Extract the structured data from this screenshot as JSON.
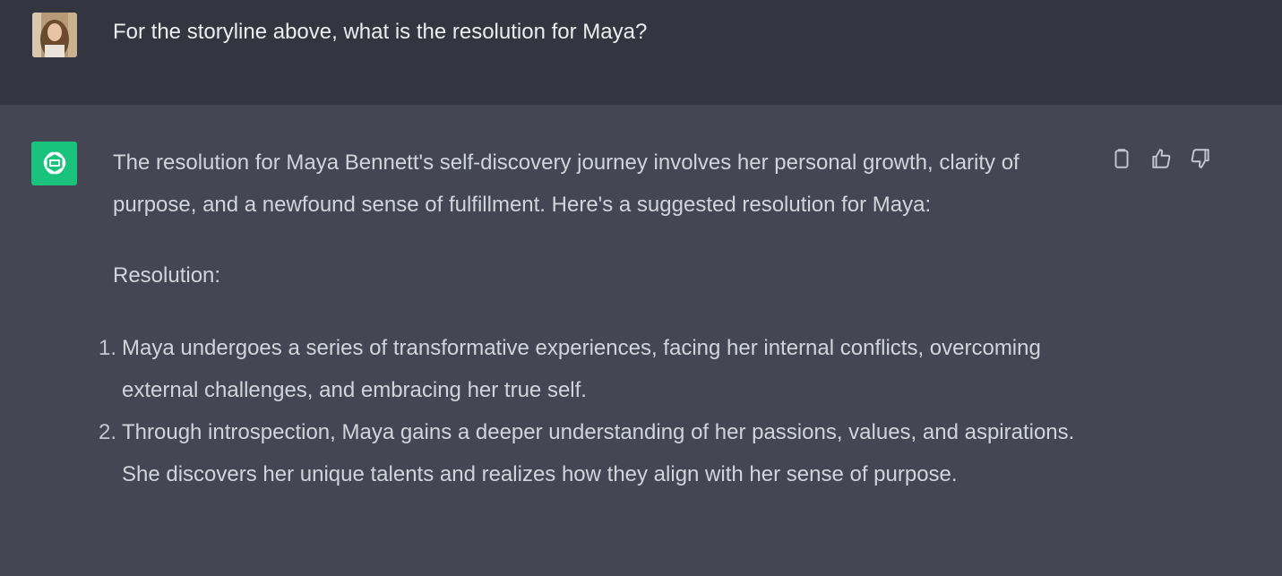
{
  "user_message": {
    "text": "For the storyline above, what is the resolution for Maya?"
  },
  "assistant_message": {
    "intro": "The resolution for Maya Bennett's self-discovery journey involves her personal growth, clarity of purpose, and a newfound sense of fulfillment. Here's a suggested resolution for Maya:",
    "heading": "Resolution:",
    "list": [
      {
        "number": "1.",
        "text": "Maya undergoes a series of transformative experiences, facing her internal conflicts, overcoming external challenges, and embracing her true self."
      },
      {
        "number": "2.",
        "text": "Through introspection, Maya gains a deeper understanding of her passions, values, and aspirations. She discovers her unique talents and realizes how they align with her sense of purpose."
      }
    ]
  },
  "actions": {
    "copy_icon": "clipboard-icon",
    "like_icon": "thumbs-up-icon",
    "dislike_icon": "thumbs-down-icon"
  },
  "colors": {
    "user_bg": "#343541",
    "assistant_bg": "#444654",
    "gpt_avatar": "#19c37d",
    "text": "#d1d5db"
  }
}
